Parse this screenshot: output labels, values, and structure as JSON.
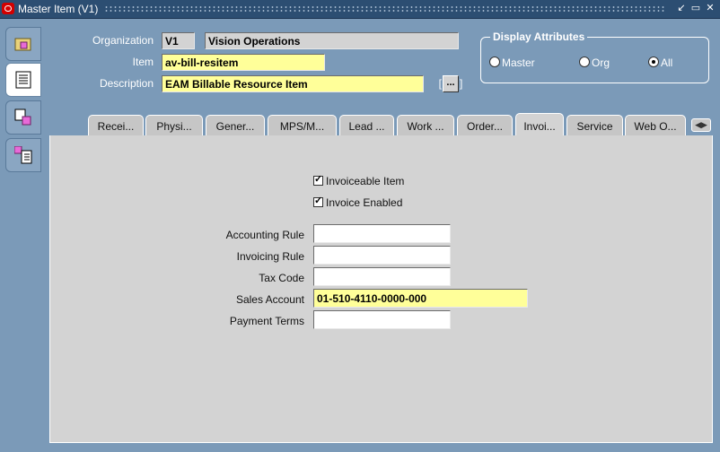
{
  "window": {
    "title": "Master Item (V1)"
  },
  "header": {
    "organization_label": "Organization",
    "organization_code": "V1",
    "organization_name": "Vision Operations",
    "item_label": "Item",
    "item_value": "av-bill-resitem",
    "description_label": "Description",
    "description_value": "EAM Billable Resource Item",
    "bracket_open": "[",
    "flex_button": "...",
    "bracket_close": "]"
  },
  "display_attributes": {
    "legend": "Display Attributes",
    "options": [
      "Master",
      "Org",
      "All"
    ],
    "selected": "All"
  },
  "tabs": [
    {
      "label": "Recei..."
    },
    {
      "label": "Physi..."
    },
    {
      "label": "Gener..."
    },
    {
      "label": "MPS/M..."
    },
    {
      "label": "Lead ..."
    },
    {
      "label": "Work ..."
    },
    {
      "label": "Order..."
    },
    {
      "label": "Invoi..."
    },
    {
      "label": "Service"
    },
    {
      "label": "Web O..."
    }
  ],
  "active_tab": "Invoi...",
  "invoicing": {
    "invoiceable_item": {
      "label": "Invoiceable Item",
      "checked": true
    },
    "invoice_enabled": {
      "label": "Invoice Enabled",
      "checked": true
    },
    "accounting_rule": {
      "label": "Accounting Rule",
      "value": ""
    },
    "invoicing_rule": {
      "label": "Invoicing Rule",
      "value": ""
    },
    "tax_code": {
      "label": "Tax Code",
      "value": ""
    },
    "sales_account": {
      "label": "Sales Account",
      "value": "01-510-4110-0000-000"
    },
    "payment_terms": {
      "label": "Payment Terms",
      "value": ""
    }
  },
  "colors": {
    "window_bg": "#7b9ab8",
    "titlebar": "#2c4e72",
    "panel": "#d3d3d3",
    "required_field": "#ffff99"
  }
}
